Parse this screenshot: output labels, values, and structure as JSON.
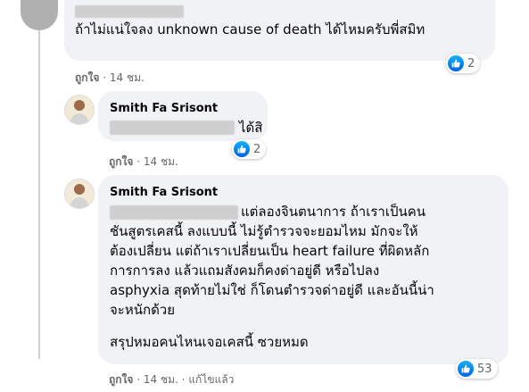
{
  "colors": {
    "bubble": "#f0f2f5",
    "meta": "#65676b",
    "like": "#1877f2",
    "text": "#050505"
  },
  "comments": [
    {
      "author": "",
      "text": "ถ้าไม่แน่ใจลง unknown cause of death ได้ไหมครับพี่สมิท",
      "reaction_count": "2",
      "like_label": "ถูกใจ",
      "time": "14 ชม.",
      "reaction_icon": "like-icon"
    },
    {
      "author": "Smith Fa Srisont",
      "text": "ได้สิ",
      "reaction_count": "2",
      "like_label": "ถูกใจ",
      "time": "14 ชม.",
      "reaction_icon": "like-icon"
    },
    {
      "author": "Smith Fa Srisont",
      "text_lines": [
        "แต่ลองจินตนาการ ถ้าเราเป็นคน",
        "ชันสูตรเคสนี้ ลงแบบนี้ ไม่รู้ตำรวจจะยอมไหม มักจะให้",
        "ต้องเปลี่ยน แต่ถ้าเราเปลี่ยนเป็น heart failure ที่ผิดหลัก",
        "การการลง แล้วแถมสังคมก็คงด่าอยู่ดี หรือไปลง",
        "asphyxia สุดท้ายไม่ใช่ ก็โดนตำรวจด่าอยู่ดี และอันนี้น่า",
        "จะหนักด้วย"
      ],
      "summary": "สรุปหมอคนไหนเจอเคสนี้ ซวยหมด",
      "reaction_count": "53",
      "like_label": "ถูกใจ",
      "time": "14 ชม.",
      "edited_label": "แก้ไขแล้ว",
      "reaction_icon": "like-icon"
    }
  ]
}
